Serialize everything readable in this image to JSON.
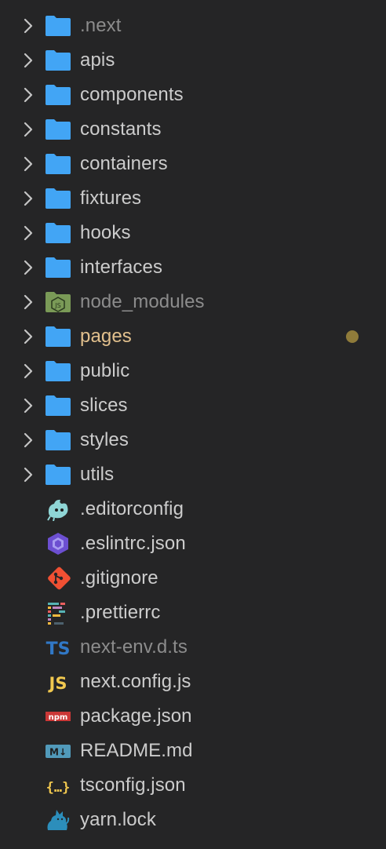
{
  "explorer": {
    "items": [
      {
        "label": ".next",
        "kind": "folder",
        "icon": "folder-icon",
        "dim": true
      },
      {
        "label": "apis",
        "kind": "folder",
        "icon": "folder-icon"
      },
      {
        "label": "components",
        "kind": "folder",
        "icon": "folder-icon"
      },
      {
        "label": "constants",
        "kind": "folder",
        "icon": "folder-icon"
      },
      {
        "label": "containers",
        "kind": "folder",
        "icon": "folder-icon"
      },
      {
        "label": "fixtures",
        "kind": "folder",
        "icon": "folder-icon"
      },
      {
        "label": "hooks",
        "kind": "folder",
        "icon": "folder-icon"
      },
      {
        "label": "interfaces",
        "kind": "folder",
        "icon": "folder-icon"
      },
      {
        "label": "node_modules",
        "kind": "folder",
        "icon": "nodejs-folder-icon",
        "dim": true
      },
      {
        "label": "pages",
        "kind": "folder",
        "icon": "folder-icon",
        "modified": true
      },
      {
        "label": "public",
        "kind": "folder",
        "icon": "folder-icon"
      },
      {
        "label": "slices",
        "kind": "folder",
        "icon": "folder-icon"
      },
      {
        "label": "styles",
        "kind": "folder",
        "icon": "folder-icon"
      },
      {
        "label": "utils",
        "kind": "folder",
        "icon": "folder-icon"
      },
      {
        "label": ".editorconfig",
        "kind": "file",
        "icon": "editorconfig-icon"
      },
      {
        "label": ".eslintrc.json",
        "kind": "file",
        "icon": "eslint-icon"
      },
      {
        "label": ".gitignore",
        "kind": "file",
        "icon": "git-icon"
      },
      {
        "label": ".prettierrc",
        "kind": "file",
        "icon": "prettier-icon"
      },
      {
        "label": "next-env.d.ts",
        "kind": "file",
        "icon": "typescript-icon",
        "dim": true
      },
      {
        "label": "next.config.js",
        "kind": "file",
        "icon": "javascript-icon"
      },
      {
        "label": "package.json",
        "kind": "file",
        "icon": "npm-icon"
      },
      {
        "label": "README.md",
        "kind": "file",
        "icon": "markdown-icon"
      },
      {
        "label": "tsconfig.json",
        "kind": "file",
        "icon": "json-icon"
      },
      {
        "label": "yarn.lock",
        "kind": "file",
        "icon": "yarn-icon"
      }
    ]
  },
  "colors": {
    "background": "#252526",
    "text": "#cccccc",
    "text_dim": "#8c8c8c",
    "text_modified": "#e2c08d",
    "folder_blue": "#42a5f5",
    "modified_dot": "#8f7b3a",
    "chevron": "#c5c5c5",
    "typescript_blue": "#3178c6",
    "javascript_yellow": "#f1c84f",
    "git_orange": "#f05033",
    "npm_red": "#cb3837",
    "eslint_purple": "#6c4fd1",
    "yarn_blue": "#2c8ebb",
    "node_green": "#7a9a57",
    "editorconfig_teal": "#8fd5d5"
  },
  "icon_glyphs": {
    "typescript-icon": "TS",
    "javascript-icon": "JS",
    "npm-icon": "npm",
    "json-icon": "{…}",
    "markdown-icon": "M↓",
    "nodejs-folder-icon": "JS"
  }
}
